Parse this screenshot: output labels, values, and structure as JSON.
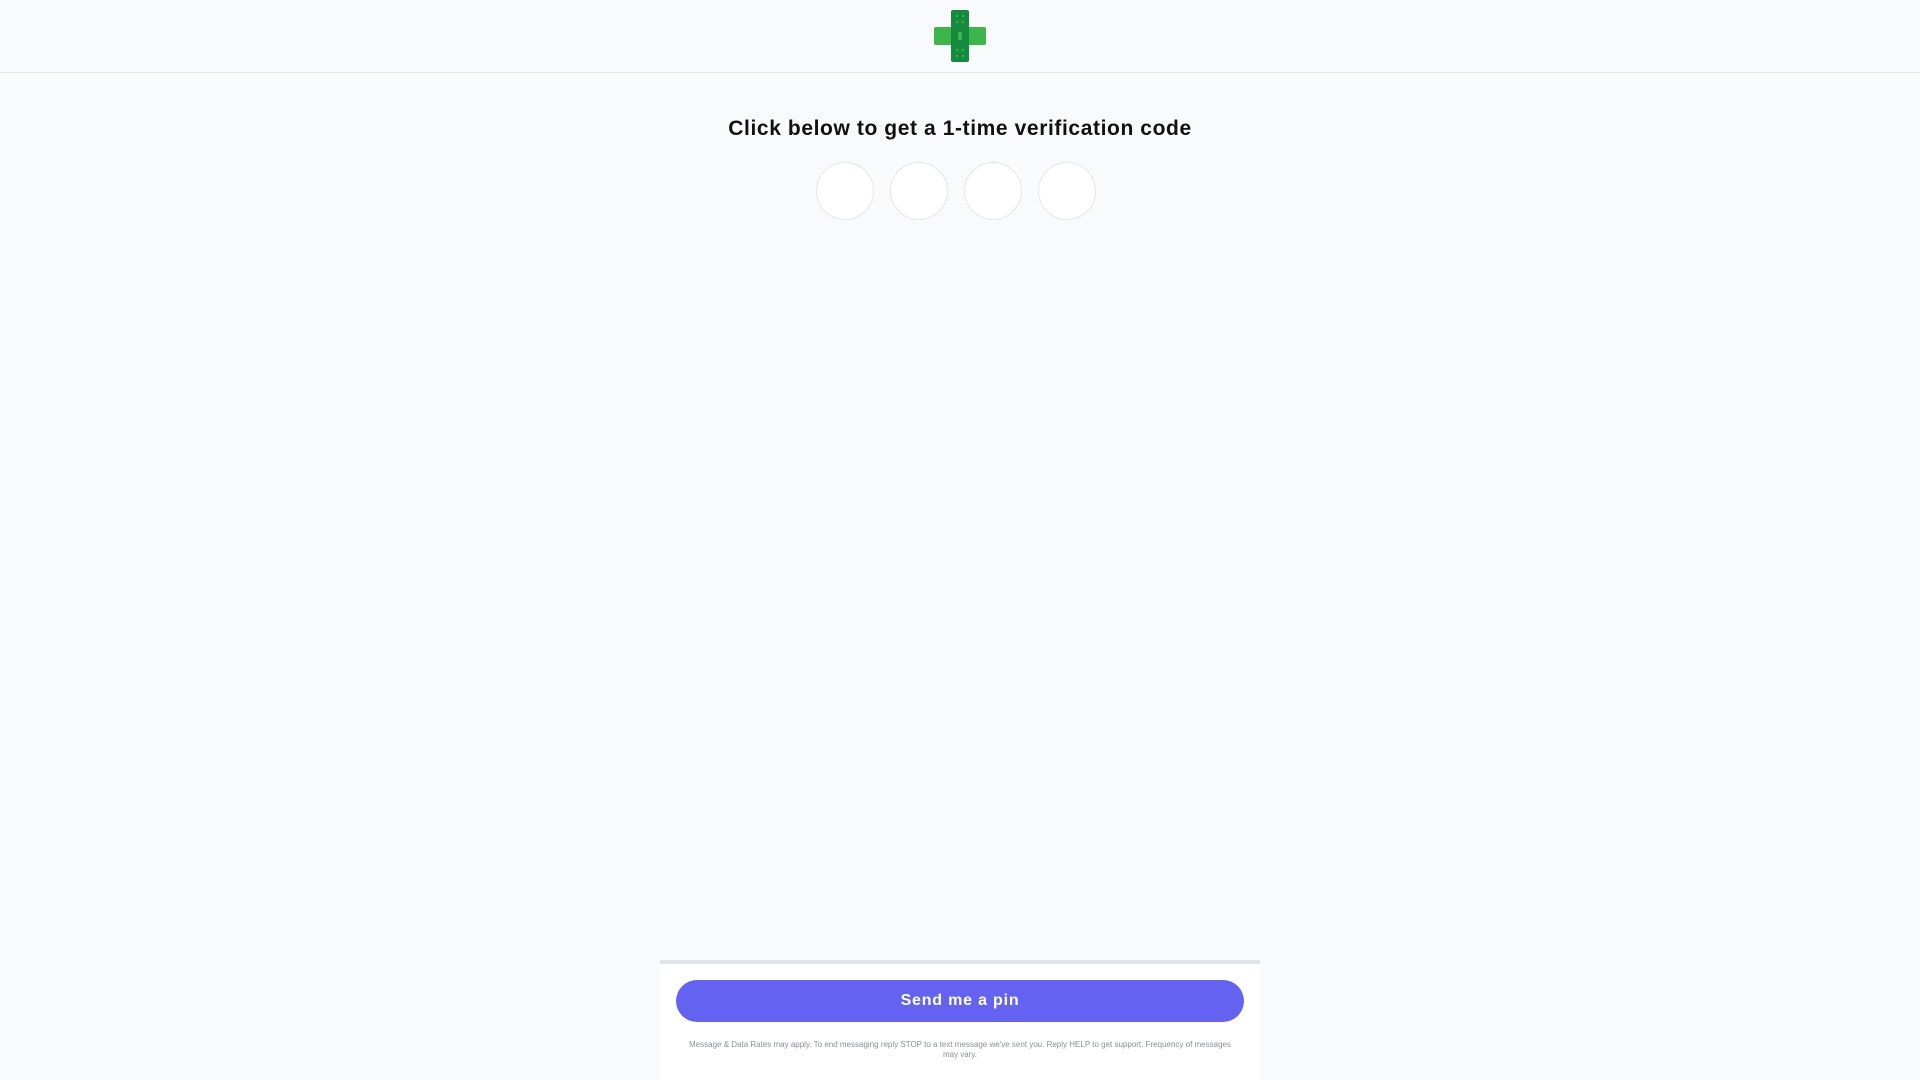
{
  "header": {
    "logo_icon": "medical-cross-logo-icon",
    "brand_colors": {
      "light_green": "#3cb54a",
      "dark_green": "#148a3c"
    }
  },
  "main": {
    "title": "Click below to get a 1-time verification code",
    "pin_inputs": [
      {
        "value": ""
      },
      {
        "value": ""
      },
      {
        "value": ""
      },
      {
        "value": ""
      }
    ]
  },
  "footer": {
    "send_button_label": "Send me a pin",
    "disclaimer": "Message & Data Rates may apply. To end messaging reply STOP to a text message we've sent you. Reply HELP to get support. Frequency of messages may vary.",
    "accent_color": "#6362f1"
  }
}
